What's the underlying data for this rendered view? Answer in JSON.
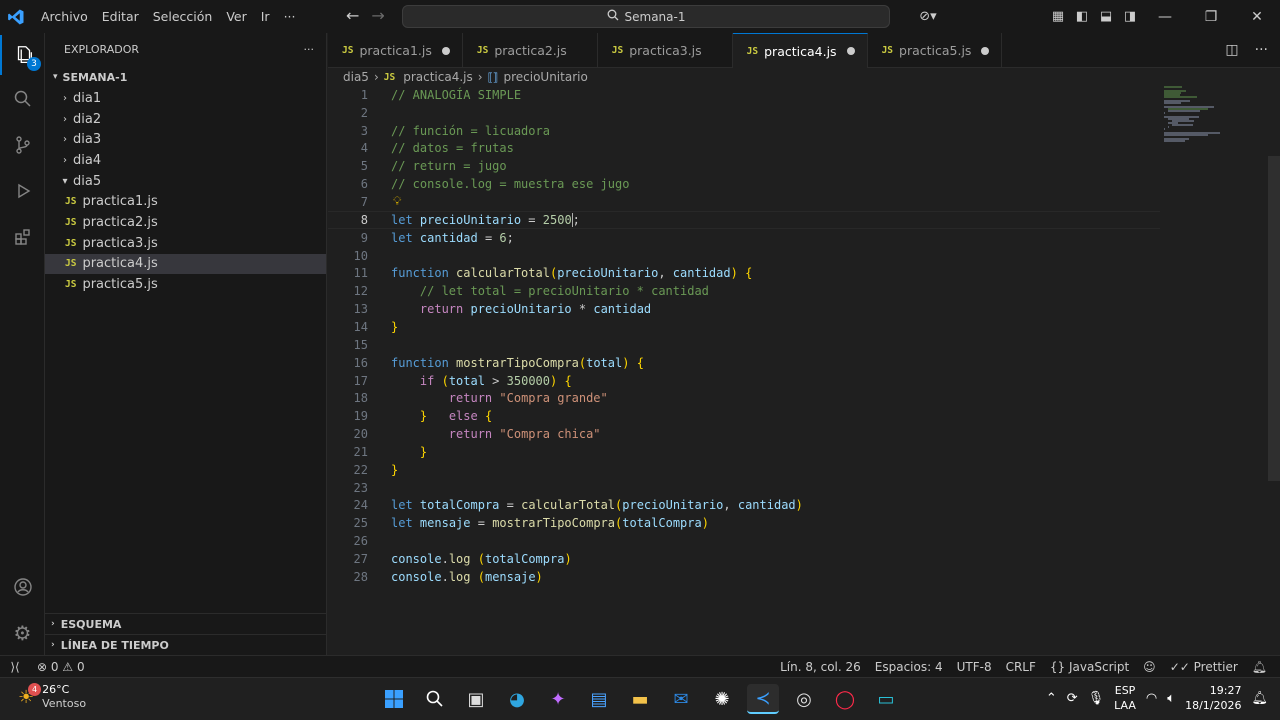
{
  "window": {
    "menu": [
      "Archivo",
      "Editar",
      "Selección",
      "Ver",
      "Ir",
      "···"
    ],
    "search": "Semana-1"
  },
  "activity": {
    "explorer_badge": "3"
  },
  "sidebar": {
    "title": "EXPLORADOR",
    "more": "···",
    "folder": "SEMANA-1",
    "items": [
      {
        "label": "dia1",
        "type": "folder",
        "open": false
      },
      {
        "label": "dia2",
        "type": "folder",
        "open": false
      },
      {
        "label": "dia3",
        "type": "folder",
        "open": false
      },
      {
        "label": "dia4",
        "type": "folder",
        "open": false
      },
      {
        "label": "dia5",
        "type": "folder",
        "open": true
      },
      {
        "label": "practica1.js",
        "type": "file"
      },
      {
        "label": "practica2.js",
        "type": "file"
      },
      {
        "label": "practica3.js",
        "type": "file"
      },
      {
        "label": "practica4.js",
        "type": "file",
        "selected": true
      },
      {
        "label": "practica5.js",
        "type": "file"
      }
    ],
    "outline": "ESQUEMA",
    "timeline": "LÍNEA DE TIEMPO"
  },
  "tabs": [
    {
      "label": "practica1.js",
      "dirty": true,
      "active": false
    },
    {
      "label": "practica2.js",
      "dirty": false,
      "active": false
    },
    {
      "label": "practica3.js",
      "dirty": false,
      "active": false
    },
    {
      "label": "practica4.js",
      "dirty": true,
      "active": true
    },
    {
      "label": "practica5.js",
      "dirty": true,
      "active": false
    }
  ],
  "breadcrumb": {
    "folder": "dia5",
    "file": "practica4.js",
    "symbol": "precioUnitario",
    "js": "JS"
  },
  "code": [
    "// ANALOGÍA SIMPLE",
    "",
    "// función = licuadora",
    "// datos = frutas",
    "// return = jugo",
    "// console.log = muestra ese jugo",
    "",
    "let precioUnitario = 2500;",
    "let cantidad = 6;",
    "",
    "function calcularTotal(precioUnitario, cantidad) {",
    "    // let total = precioUnitario * cantidad",
    "    return precioUnitario * cantidad",
    "}",
    "",
    "function mostrarTipoCompra(total) {",
    "    if (total > 350000) {",
    "        return \"Compra grande\"",
    "    }   else {",
    "        return \"Compra chica\"",
    "    }",
    "}",
    "",
    "let totalCompra = calcularTotal(precioUnitario, cantidad)",
    "let mensaje = mostrarTipoCompra(totalCompra)",
    "",
    "console.log (totalCompra)",
    "console.log (mensaje)"
  ],
  "current_line": 8,
  "status": {
    "errors": "0",
    "warnings": "0",
    "position": "Lín. 8, col. 26",
    "spaces": "Espacios: 4",
    "encoding": "UTF-8",
    "eol": "CRLF",
    "language": "JavaScript",
    "prettier": "Prettier"
  },
  "taskbar": {
    "temp": "26°C",
    "weather": "Ventoso",
    "weather_badge": "4",
    "lang": "ESP",
    "layout": "LAA",
    "time": "19:27",
    "date": "18/1/2026"
  },
  "colors": {
    "accent": "#0078d4",
    "comment": "#6a9955",
    "keyword": "#569cd6",
    "function": "#dcdcaa",
    "variable": "#9cdcfe",
    "number": "#b5cea8",
    "string": "#ce9178"
  }
}
